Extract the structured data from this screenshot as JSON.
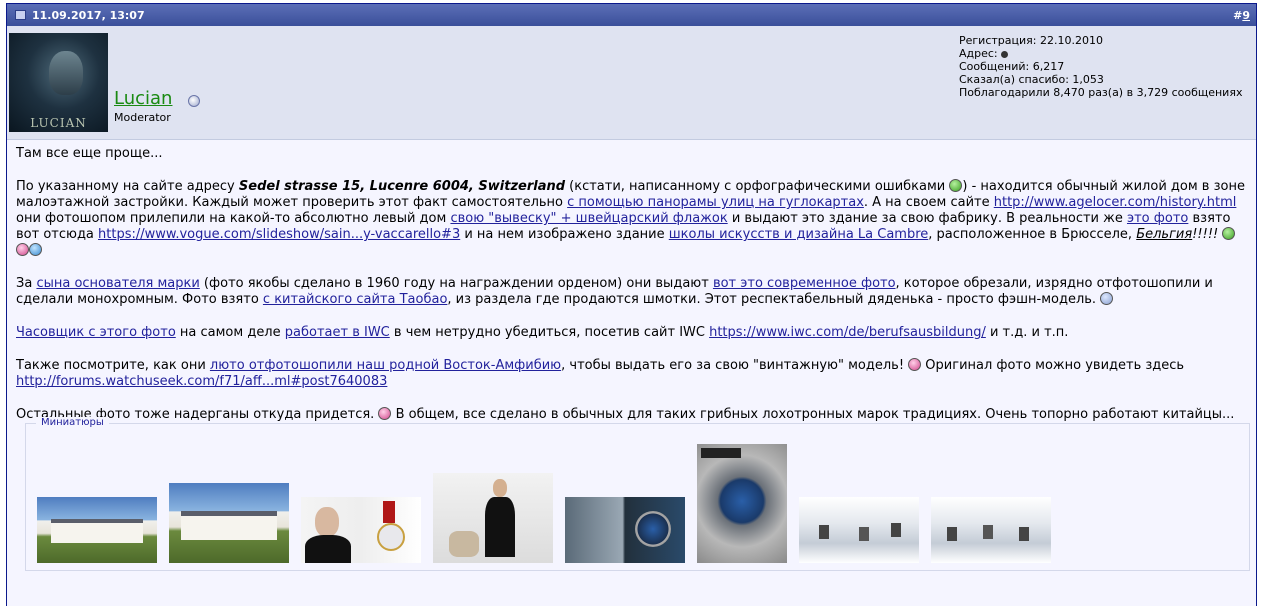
{
  "post": {
    "date": "11.09.2017, 13:07",
    "number_prefix": "#",
    "number": "9"
  },
  "user": {
    "avatar_caption": "LUCIAN",
    "name": "Lucian",
    "title": "Moderator",
    "info": {
      "registration": "Регистрация: 22.10.2010",
      "address": "Адрес:",
      "messages": "Сообщений: 6,217",
      "thanks_said": "Сказал(а) спасибо: 1,053",
      "thanked": "Поблагодарили 8,470 раз(а) в 3,729 сообщениях"
    }
  },
  "message": {
    "p1": "Там все еще проще...",
    "p2": {
      "t1": "По указанному на сайте адресу ",
      "addr": "Sedel strasse 15, Lucenre 6004, Switzerland",
      "t2": " (кстати, написанному с орфографическими ошибками ",
      "t3": ") - находится обычный жилой дом в зоне малоэтажной застройки. Каждый может проверить этот факт самостоятельно ",
      "l1": "с помощью панорамы улиц на гуглокартах",
      "t4": ". А на своем сайте ",
      "l2": "http://www.agelocer.com/history.html",
      "t5": " они фотошопом прилепили на какой-то абсолютно левый дом ",
      "l3": "свою \"вывеску\" + швейцарский флажок",
      "t6": " и выдают это здание за свою фабрику. В реальности же ",
      "l4": "это фото",
      "t7": " взято вот отсюда ",
      "l5": "https://www.vogue.com/slideshow/sain...y-vaccarello#3",
      "t8": " и на нем изображено здание ",
      "l6": "школы искусств и дизайна La Cambre",
      "t9": ", расположенное в Брюсселе, ",
      "country": "Бельгия",
      "t10": "!!!!! "
    },
    "p3": {
      "t1": "За ",
      "l1": "сына основателя марки",
      "t2": " (фото якобы сделано в 1960 году на награждении орденом) они выдают ",
      "l2": "вот это современное фото",
      "t3": ", которое обрезали, изрядно отфотошопили и сделали монохромным. Фото взято ",
      "l3": "с китайского сайта Таобао",
      "t4": ", из раздела где продаются шмотки. Этот респектабельный дяденька - просто фэшн-модель. "
    },
    "p4": {
      "l1": "Часовщик с этого фото",
      "t1": " на самом деле ",
      "l2": "работает в IWC",
      "t2": " в чем нетрудно убедиться, посетив сайт IWC ",
      "l3": "https://www.iwc.com/de/berufsausbildung/",
      "t3": " и т.д. и т.п."
    },
    "p5": {
      "t1": "Также посмотрите, как они ",
      "l1": "люто отфотошопили наш родной Восток-Амфибию",
      "t2": ", чтобы выдать его за свою \"винтажную\" модель! ",
      "t3": " Оригинал фото можно увидеть здесь ",
      "l2": "http://forums.watchuseek.com/f71/aff...ml#post7640083"
    },
    "p6": {
      "t1": "Остальные фото тоже надерганы откуда придется. ",
      "t2": " В общем, все сделано в обычных для таких грибных лохотронных марок традициях. Очень топорно работают китайцы..."
    }
  },
  "attachments": {
    "legend": "Миниатюры",
    "items": [
      "building-photo-1",
      "building-photo-2",
      "portrait-and-medal-photo",
      "man-in-suit-photo",
      "harbor-watch-photo",
      "blue-dial-watch-photo",
      "watchmaker-workshop-photo-1",
      "watchmaker-workshop-photo-2"
    ]
  },
  "colors": {
    "header": "#3a4f9a",
    "userbar": "#dfe3f1",
    "body": "#f5f5ff",
    "link": "#22229c",
    "username": "#1a8a12"
  }
}
